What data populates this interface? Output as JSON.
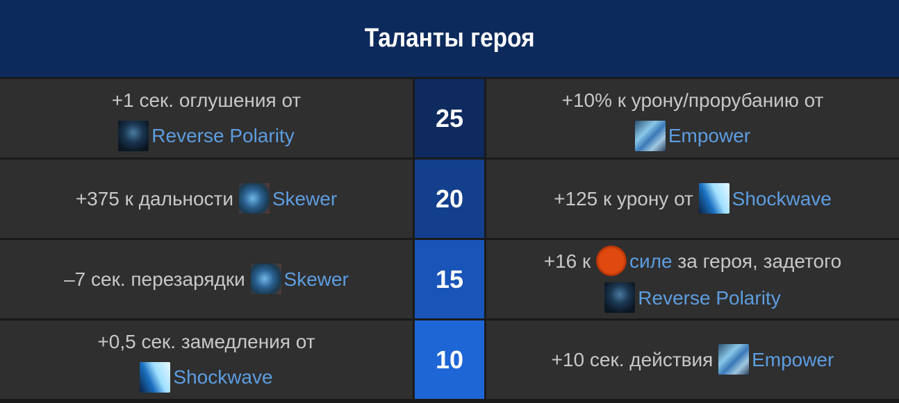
{
  "title": "Таланты героя",
  "colors": {
    "header_bg": "#0d2a5c",
    "lvl25": "#0e2a5e",
    "lvl20": "#133f8c",
    "lvl15": "#1955b8",
    "lvl10": "#1e66d6",
    "link": "#5d9de0"
  },
  "rows": [
    {
      "level": "25",
      "left": {
        "pre": "+1 сек. оглушения от",
        "icon": "reverse-polarity-icon",
        "link": "Reverse Polarity",
        "post": ""
      },
      "right": {
        "pre": "+10% к урону/прорубанию от",
        "icon": "empower-icon",
        "link": "Empower",
        "post": ""
      }
    },
    {
      "level": "20",
      "left": {
        "pre": "+375 к дальности",
        "icon": "skewer-icon",
        "link": "Skewer",
        "post": ""
      },
      "right": {
        "pre": "+125 к урону от",
        "icon": "shockwave-icon",
        "link": "Shockwave",
        "post": ""
      }
    },
    {
      "level": "15",
      "left": {
        "pre": "–7 сек. перезарядки",
        "icon": "skewer-icon",
        "link": "Skewer",
        "post": ""
      },
      "right": {
        "pre": "+16 к",
        "icon": "strength-icon",
        "link": "силе",
        "post": "за героя, задетого",
        "icon2": "reverse-polarity-icon",
        "link2": "Reverse Polarity"
      }
    },
    {
      "level": "10",
      "left": {
        "pre": "+0,5 сек. замедления от",
        "icon": "shockwave-icon",
        "link": "Shockwave",
        "post": ""
      },
      "right": {
        "pre": "+10 сек. действия",
        "icon": "empower-icon",
        "link": "Empower",
        "post": ""
      }
    }
  ]
}
